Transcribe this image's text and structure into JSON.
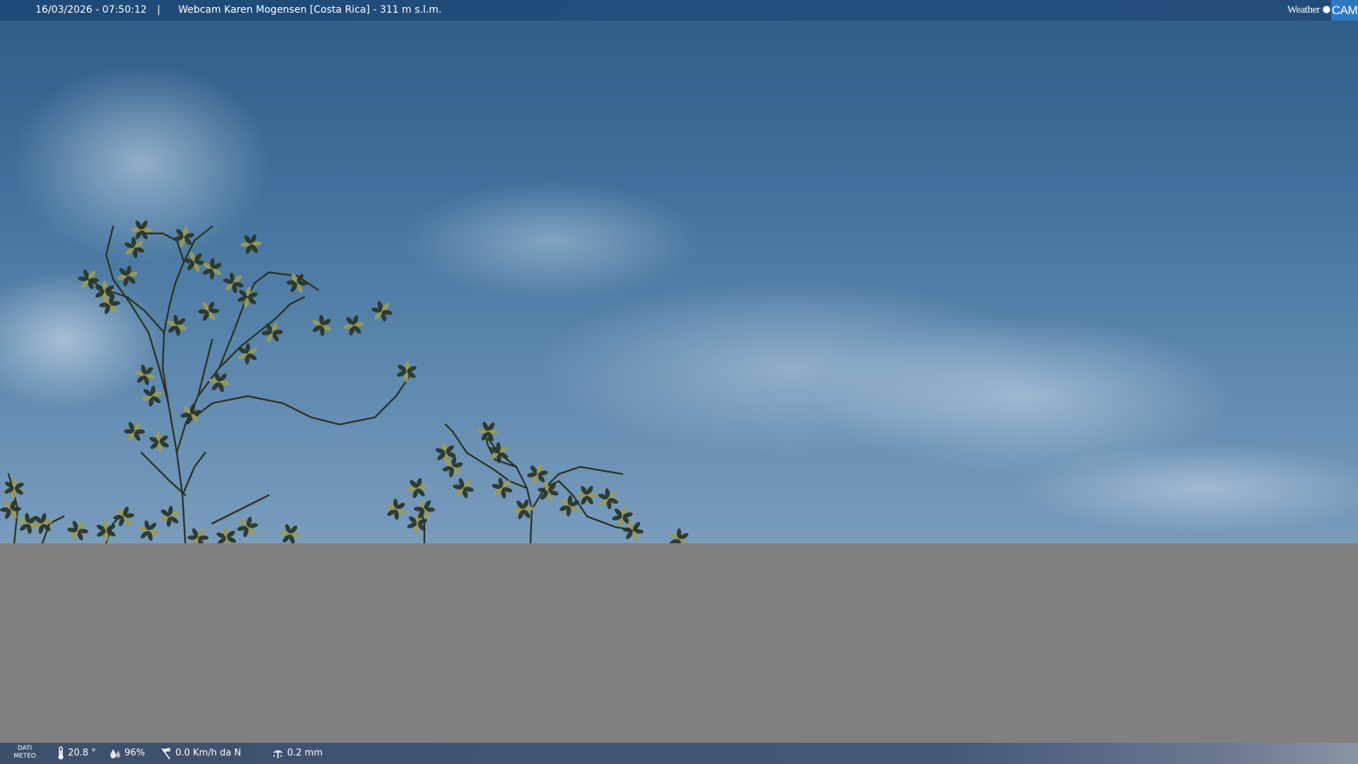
{
  "top_bar": {
    "datetime": "16/03/2026 - 07:50:12",
    "separator": "|",
    "title": "Webcam Karen Mogensen [Costa Rica]  - 311 m s.l.m."
  },
  "logo": {
    "word": "Weather",
    "cam": "CAM"
  },
  "bottom_bar": {
    "dati_label_line1": "DATI",
    "dati_label_line2": "METEO",
    "temperature": "20.8 °",
    "humidity": "96%",
    "wind": "0.0 Km/h da N",
    "rain": "0.2 mm"
  },
  "icons": {
    "temperature": "thermometer-icon",
    "humidity": "humidity-drop-icon",
    "wind": "wind-sock-icon",
    "rain": "rain-gauge-icon"
  },
  "colors": {
    "top_bar": "#1f4a78",
    "bottom_bar": "#46587a",
    "sky": "#41719c",
    "lower_fill": "#808080",
    "logo_cam_bg": "#2f78c2",
    "foliage_dark": "#2a3424",
    "foliage_light": "#9a9a58"
  }
}
